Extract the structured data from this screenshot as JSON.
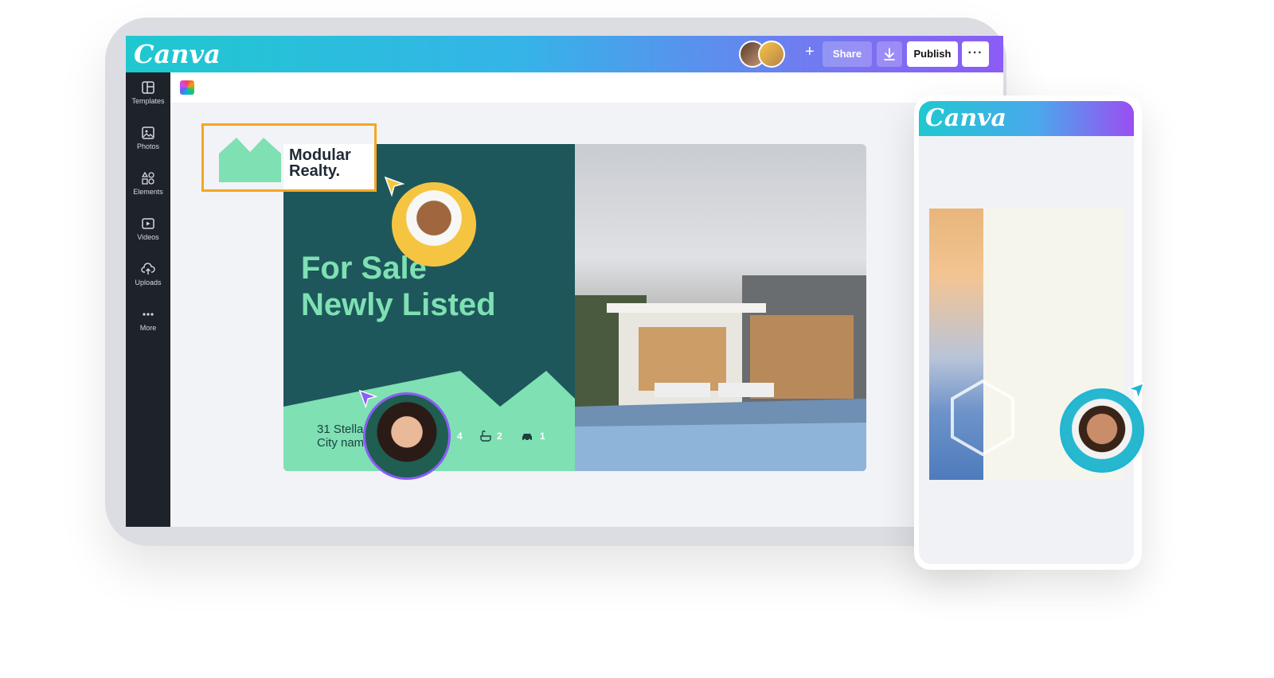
{
  "app": {
    "brand": "Canva"
  },
  "topbar": {
    "share_label": "Share",
    "publish_label": "Publish",
    "more_label": "···",
    "plus_label": "+"
  },
  "sidebar": {
    "items": [
      {
        "label": "Templates",
        "icon": "templates-icon"
      },
      {
        "label": "Photos",
        "icon": "photos-icon"
      },
      {
        "label": "Elements",
        "icon": "elements-icon"
      },
      {
        "label": "Videos",
        "icon": "videos-icon"
      },
      {
        "label": "Uploads",
        "icon": "uploads-icon"
      },
      {
        "label": "More",
        "icon": "more-icon"
      }
    ]
  },
  "design": {
    "brand_line1": "Modular",
    "brand_line2": "Realty.",
    "headline_line1": "For Sale",
    "headline_line2": "Newly Listed",
    "address_line1": "31 Stella",
    "address_line2": "City nam",
    "beds": "4",
    "baths": "2",
    "cars": "1"
  },
  "phone": {
    "brand": "Canva"
  },
  "colors": {
    "teal": "#1e575b",
    "mint": "#7ee0b3",
    "accent": "#f5a623",
    "gradient_start": "#1fc8d0",
    "gradient_end": "#8b5cf6"
  }
}
